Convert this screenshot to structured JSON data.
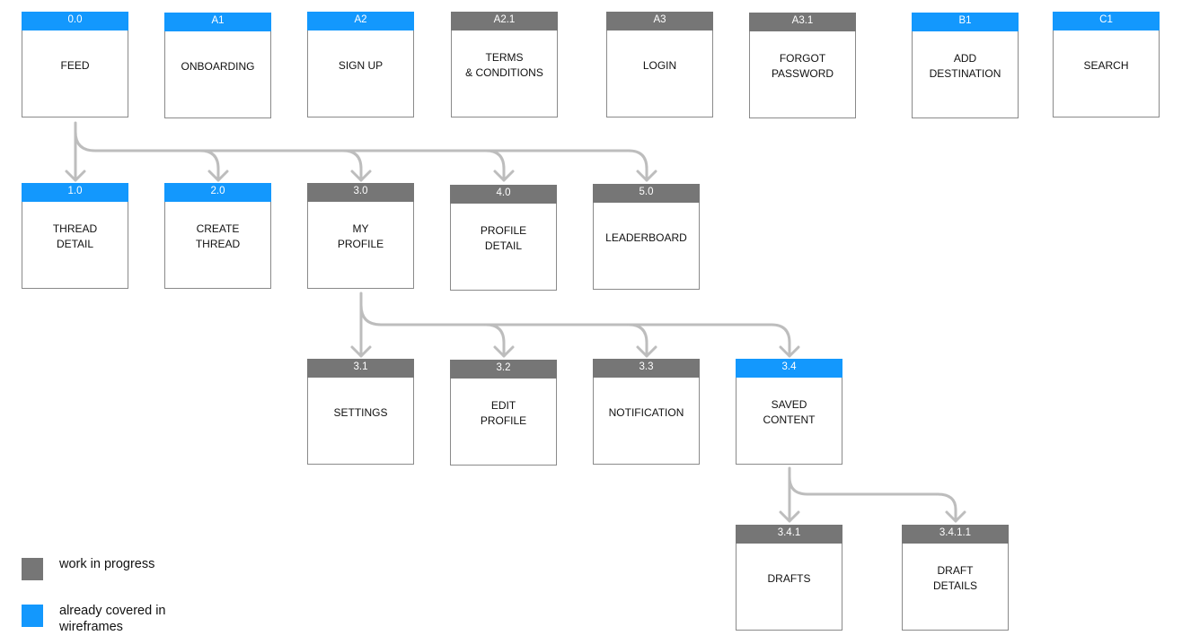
{
  "colors": {
    "work_in_progress": "#767676",
    "already_covered": "#1398FD",
    "connector": "#BDBDBD"
  },
  "nodes": {
    "n0_0": {
      "id": "0.0",
      "title": "FEED",
      "status": "already_covered"
    },
    "nA1": {
      "id": "A1",
      "title": "ONBOARDING",
      "status": "already_covered"
    },
    "nA2": {
      "id": "A2",
      "title": "SIGN UP",
      "status": "already_covered"
    },
    "nA2_1": {
      "id": "A2.1",
      "title": "TERMS\n& CONDITIONS",
      "status": "work_in_progress"
    },
    "nA3": {
      "id": "A3",
      "title": "LOGIN",
      "status": "work_in_progress"
    },
    "nA3_1": {
      "id": "A3.1",
      "title": "FORGOT\nPASSWORD",
      "status": "work_in_progress"
    },
    "nB1": {
      "id": "B1",
      "title": "ADD\nDESTINATION",
      "status": "already_covered"
    },
    "nC1": {
      "id": "C1",
      "title": "SEARCH",
      "status": "already_covered"
    },
    "n1_0": {
      "id": "1.0",
      "title": "THREAD\nDETAIL",
      "status": "already_covered"
    },
    "n2_0": {
      "id": "2.0",
      "title": "CREATE\nTHREAD",
      "status": "already_covered"
    },
    "n3_0": {
      "id": "3.0",
      "title": "MY\nPROFILE",
      "status": "work_in_progress"
    },
    "n4_0": {
      "id": "4.0",
      "title": "PROFILE\nDETAIL",
      "status": "work_in_progress"
    },
    "n5_0": {
      "id": "5.0",
      "title": "LEADERBOARD",
      "status": "work_in_progress"
    },
    "n3_1": {
      "id": "3.1",
      "title": "SETTINGS",
      "status": "work_in_progress"
    },
    "n3_2": {
      "id": "3.2",
      "title": "EDIT\nPROFILE",
      "status": "work_in_progress"
    },
    "n3_3": {
      "id": "3.3",
      "title": "NOTIFICATION",
      "status": "work_in_progress"
    },
    "n3_4": {
      "id": "3.4",
      "title": "SAVED\nCONTENT",
      "status": "already_covered"
    },
    "n3_4_1": {
      "id": "3.4.1",
      "title": "DRAFTS",
      "status": "work_in_progress"
    },
    "n3_4_1_1": {
      "id": "3.4.1.1",
      "title": "DRAFT\nDETAILS",
      "status": "work_in_progress"
    }
  },
  "edges": [
    {
      "from": "0.0",
      "to": "1.0"
    },
    {
      "from": "0.0",
      "to": "2.0"
    },
    {
      "from": "0.0",
      "to": "3.0"
    },
    {
      "from": "0.0",
      "to": "4.0"
    },
    {
      "from": "0.0",
      "to": "5.0"
    },
    {
      "from": "3.0",
      "to": "3.1"
    },
    {
      "from": "3.0",
      "to": "3.2"
    },
    {
      "from": "3.0",
      "to": "3.3"
    },
    {
      "from": "3.0",
      "to": "3.4"
    },
    {
      "from": "3.4",
      "to": "3.4.1"
    },
    {
      "from": "3.4",
      "to": "3.4.1.1"
    }
  ],
  "legend": {
    "work_in_progress": "work in progress",
    "already_covered": "already covered in\nwireframes"
  }
}
